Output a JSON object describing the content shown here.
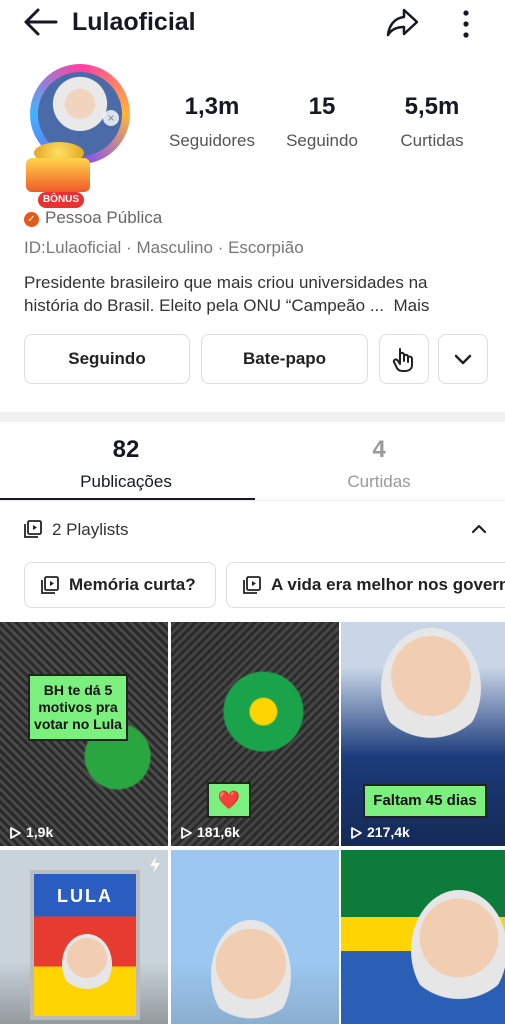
{
  "header": {
    "title": "Lulaoficial"
  },
  "profile": {
    "bonus_badge": "BÔNUS",
    "account_type": "Pessoa Pública",
    "meta": [
      "ID:Lulaoficial",
      "Masculino",
      "Escorpião"
    ],
    "meta_separator": " · ",
    "bio_line1": "Presidente brasileiro que mais criou universidades na",
    "bio_line2": "história do Brasil. Eleito pela ONU “Campeão ...",
    "bio_more": "Mais"
  },
  "stats": [
    {
      "value": "1,3m",
      "label": "Seguidores"
    },
    {
      "value": "15",
      "label": "Seguindo"
    },
    {
      "value": "5,5m",
      "label": "Curtidas"
    }
  ],
  "actions": {
    "following": "Seguindo",
    "chat": "Bate-papo"
  },
  "tabs": [
    {
      "count": "82",
      "label": "Publicações"
    },
    {
      "count": "4",
      "label": "Curtidas"
    }
  ],
  "playlists": {
    "header": "2 Playlists",
    "items": [
      "Memória curta?",
      "A vida era melhor nos governos"
    ]
  },
  "videos": [
    {
      "caption": "BH te dá 5 motivos pra votar no Lula",
      "views": "1,9k"
    },
    {
      "caption": "❤️",
      "views": "181,6k"
    },
    {
      "caption": "Faltam 45 dias",
      "views": "217,4k"
    },
    {
      "poster_text": "LULA"
    },
    {},
    {}
  ],
  "colors": {
    "accent": "#161823",
    "verified": "#e35b1c",
    "caption_bg": "#7cf07e"
  }
}
